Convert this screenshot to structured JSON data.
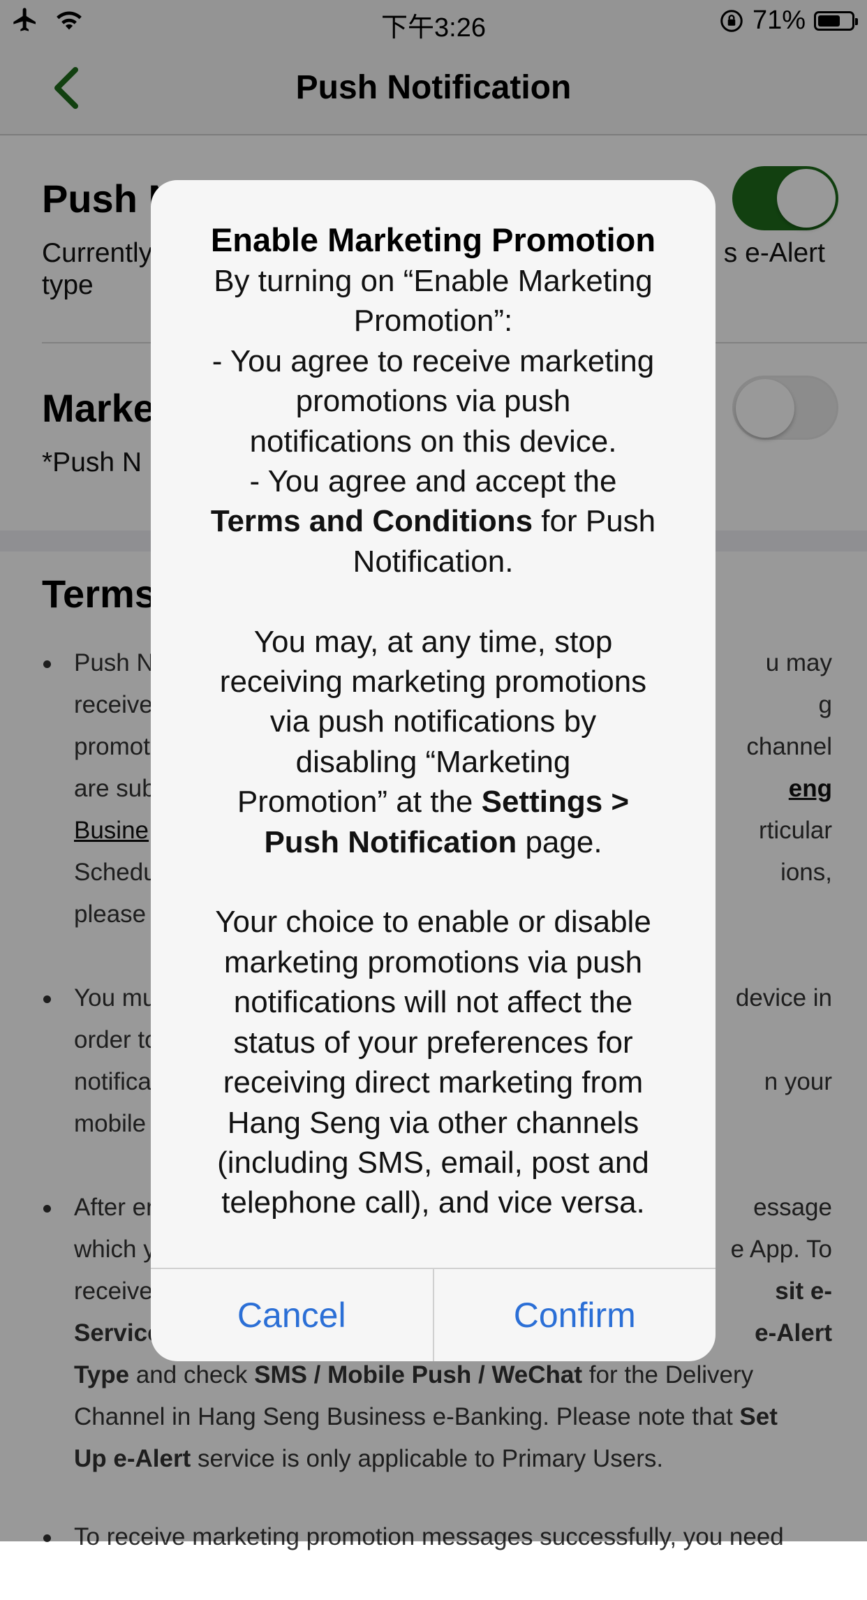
{
  "status_bar": {
    "time": "下午3:26",
    "battery_percent_label": "71%",
    "battery_level": 0.71,
    "icons": [
      "airplane-icon",
      "wifi-icon",
      "orientation-lock-icon",
      "battery-icon"
    ]
  },
  "nav": {
    "title": "Push Notification",
    "back_icon": "chevron-left-icon",
    "accent": "#1e6c1b"
  },
  "push_section": {
    "title_visible": "Push N",
    "desc_left": "Currently",
    "desc_left2": "type",
    "desc_right": "s e-Alert",
    "toggle_on": true
  },
  "marketing_section": {
    "title_visible": "Marke",
    "desc_visible": "*Push N",
    "toggle_on": false
  },
  "terms": {
    "title_visible": "Terms",
    "bullets": [
      {
        "lines_left": [
          "Push N",
          "receive",
          "promot",
          "are sub",
          "Busine",
          "Schedu",
          "please"
        ],
        "lines_right": [
          "u may",
          "g",
          "channel",
          "eng",
          "rticular",
          "ions,",
          ""
        ]
      },
      {
        "lines_left": [
          "You mu",
          "order to",
          "notifica",
          "mobile"
        ],
        "lines_right": [
          "device in",
          "",
          "n your",
          ""
        ]
      },
      {
        "lines_left": [
          "After en",
          "which y",
          "receive",
          "Service"
        ],
        "lines_right": [
          "essage",
          "e App. To",
          "sit e-",
          "e-Alert"
        ],
        "line5_a": "Type",
        "line5_b": " and check ",
        "line5_c": "SMS / Mobile Push / WeChat",
        "line5_d": " for the Delivery",
        "line6": "Channel in Hang Seng Business e-Banking. Please note that ",
        "line6_b": "Set",
        "line7_a": "Up e-Alert",
        "line7_b": " service is only applicable to Primary Users."
      }
    ],
    "cut_line": "To receive marketing promotion messages successfully, you need"
  },
  "alert": {
    "title": "Enable Marketing Promotion",
    "p1_lines": [
      "By turning on “Enable Marketing",
      "Promotion”:",
      "- You agree to receive marketing",
      "promotions via push",
      "notifications on this device.",
      "- You agree and accept the"
    ],
    "p1_bold": "Terms and Conditions",
    "p1_after_bold": " for Push",
    "p1_last": "Notification.",
    "p2_lines": [
      "You may, at any time, stop",
      "receiving marketing promotions",
      "via push notifications by",
      "disabling “Marketing"
    ],
    "p2_line5_a": "Promotion” at the ",
    "p2_line5_b": "Settings >",
    "p2_line6_a": "Push Notification",
    "p2_line6_b": " page.",
    "p3_lines": [
      "Your choice to enable or disable",
      "marketing promotions via push",
      "notifications will not affect the",
      "status of your preferences for",
      "receiving direct marketing from",
      "Hang Seng via other channels",
      "(including SMS, email, post and",
      "telephone call), and vice versa."
    ],
    "cancel_label": "Cancel",
    "confirm_label": "Confirm",
    "button_color": "#2b6fd6"
  }
}
